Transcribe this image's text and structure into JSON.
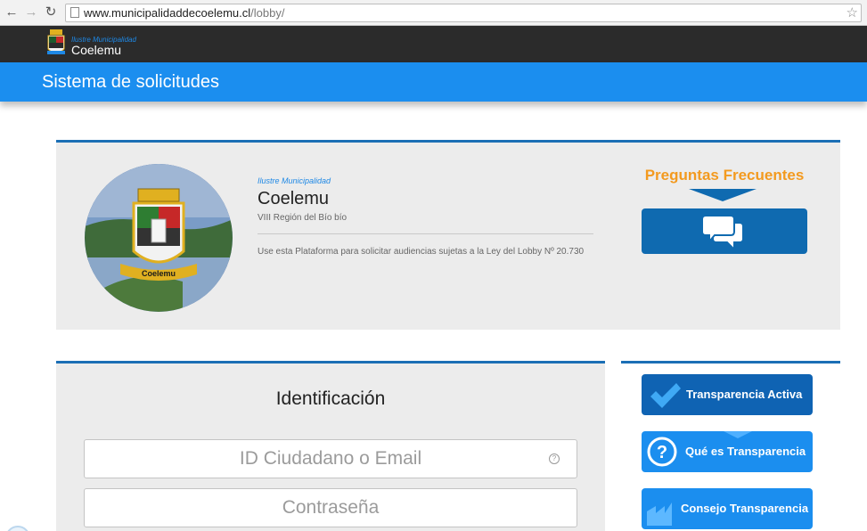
{
  "browser": {
    "url_host": "www.municipalidaddecoelemu.cl",
    "url_path": "/lobby/"
  },
  "header": {
    "logo_small": "Ilustre Municipalidad",
    "logo_big": "Coelemu",
    "app_title": "Sistema de solicitudes"
  },
  "intro": {
    "small": "Ilustre Municipalidad",
    "name": "Coelemu",
    "region": "VIII Región del Bío bío",
    "description": "Use esta Plataforma para solicitar audiencias sujetas a la Ley del Lobby Nº 20.730",
    "photo_caption": "Coelemu"
  },
  "faq": {
    "title": "Preguntas Frecuentes"
  },
  "login": {
    "title": "Identificación",
    "id_placeholder": "ID Ciudadano o Email",
    "help_icon_glyph": "?",
    "password_placeholder": "Contraseña"
  },
  "side": {
    "transparencia_activa": "Transparencia Activa",
    "que_es": "Qué es Transparencia",
    "consejo": "Consejo Transparencia"
  },
  "colors": {
    "title_bar": "#1b8eef",
    "header_dark": "#2b2b2b",
    "faq_orange": "#f39a1f",
    "button_dark_blue": "#0f63b3"
  }
}
